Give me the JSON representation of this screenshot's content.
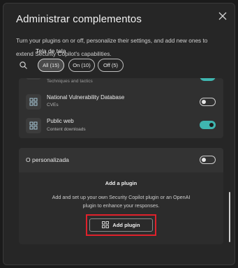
{
  "dialog": {
    "title": "Administrar complementos",
    "description": "Turn your plugins on or off, personalize their settings, and add new ones to extend Security Copilot's capabilities.",
    "overlay_text": "Tela de tela"
  },
  "filters": [
    {
      "label": "All (15)",
      "active": true
    },
    {
      "label": "On (10)",
      "active": false
    },
    {
      "label": "Off (5)",
      "active": false
    }
  ],
  "plugins": {
    "partial_top": {
      "subtitle": "Techniques and tactics",
      "enabled": true
    },
    "items": [
      {
        "name": "National Vulnerability Database",
        "subtitle": "CVEs",
        "enabled": false
      },
      {
        "name": "Public web",
        "subtitle": "Content downloads",
        "enabled": true
      }
    ]
  },
  "custom": {
    "section_label": "O personalizada",
    "enabled": false,
    "add_title": "Add a plugin",
    "add_description": "Add and set up your own Security Copilot plugin or an OpenAI plugin to enhance your responses.",
    "add_button_label": "Add plugin"
  },
  "colors": {
    "accent_teal": "#3fb6b0",
    "highlight_red": "#e0212b"
  }
}
